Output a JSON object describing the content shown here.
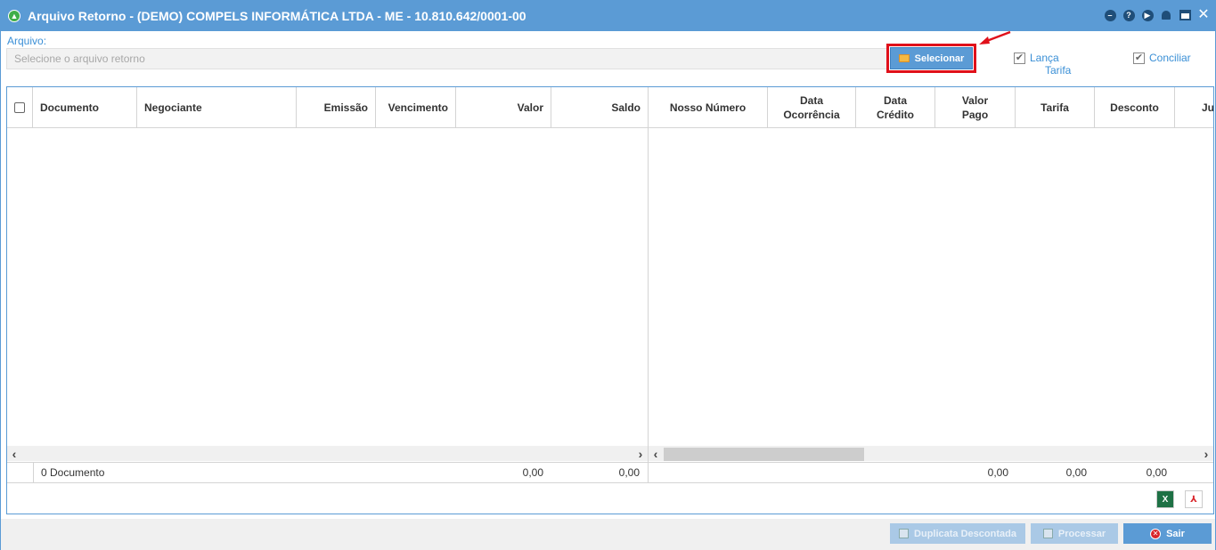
{
  "window": {
    "title": "Arquivo Retorno - (DEMO) COMPELS INFORMÁTICA LTDA - ME - 10.810.642/0001-00",
    "tools": [
      "minimize-icon",
      "help-icon",
      "play-icon",
      "notification-icon",
      "calendar-icon",
      "close-icon"
    ]
  },
  "file": {
    "label": "Arquivo:",
    "placeholder": "Selecione o arquivo retorno",
    "select_label": "Selecionar"
  },
  "options": {
    "lanca_tarifa": {
      "line1": "Lança",
      "line2": "Tarifa",
      "checked": true
    },
    "conciliar": {
      "label": "Conciliar",
      "checked": true
    }
  },
  "table": {
    "columns_left": [
      "Documento",
      "Negociante",
      "Emissão",
      "Vencimento",
      "Valor",
      "Saldo"
    ],
    "columns_right": [
      {
        "l1": "Nosso Número",
        "l2": ""
      },
      {
        "l1": "Data",
        "l2": "Ocorrência"
      },
      {
        "l1": "Data",
        "l2": "Crédito"
      },
      {
        "l1": "Valor",
        "l2": "Pago"
      },
      {
        "l1": "Tarifa",
        "l2": ""
      },
      {
        "l1": "Desconto",
        "l2": ""
      },
      {
        "l1": "Ju",
        "l2": ""
      }
    ],
    "rows": []
  },
  "footer": {
    "count": "0 Documento",
    "valor": "0,00",
    "saldo": "0,00",
    "valor_pago": "0,00",
    "tarifa": "0,00",
    "desconto": "0,00"
  },
  "export": {
    "excel": "X",
    "pdf": "⅄"
  },
  "buttons": {
    "duplicata": "Duplicata Descontada",
    "processar": "Processar",
    "sair": "Sair"
  },
  "colors": {
    "accent": "#5b9bd5",
    "highlight": "#e0101a",
    "link": "#3a8fd6"
  }
}
